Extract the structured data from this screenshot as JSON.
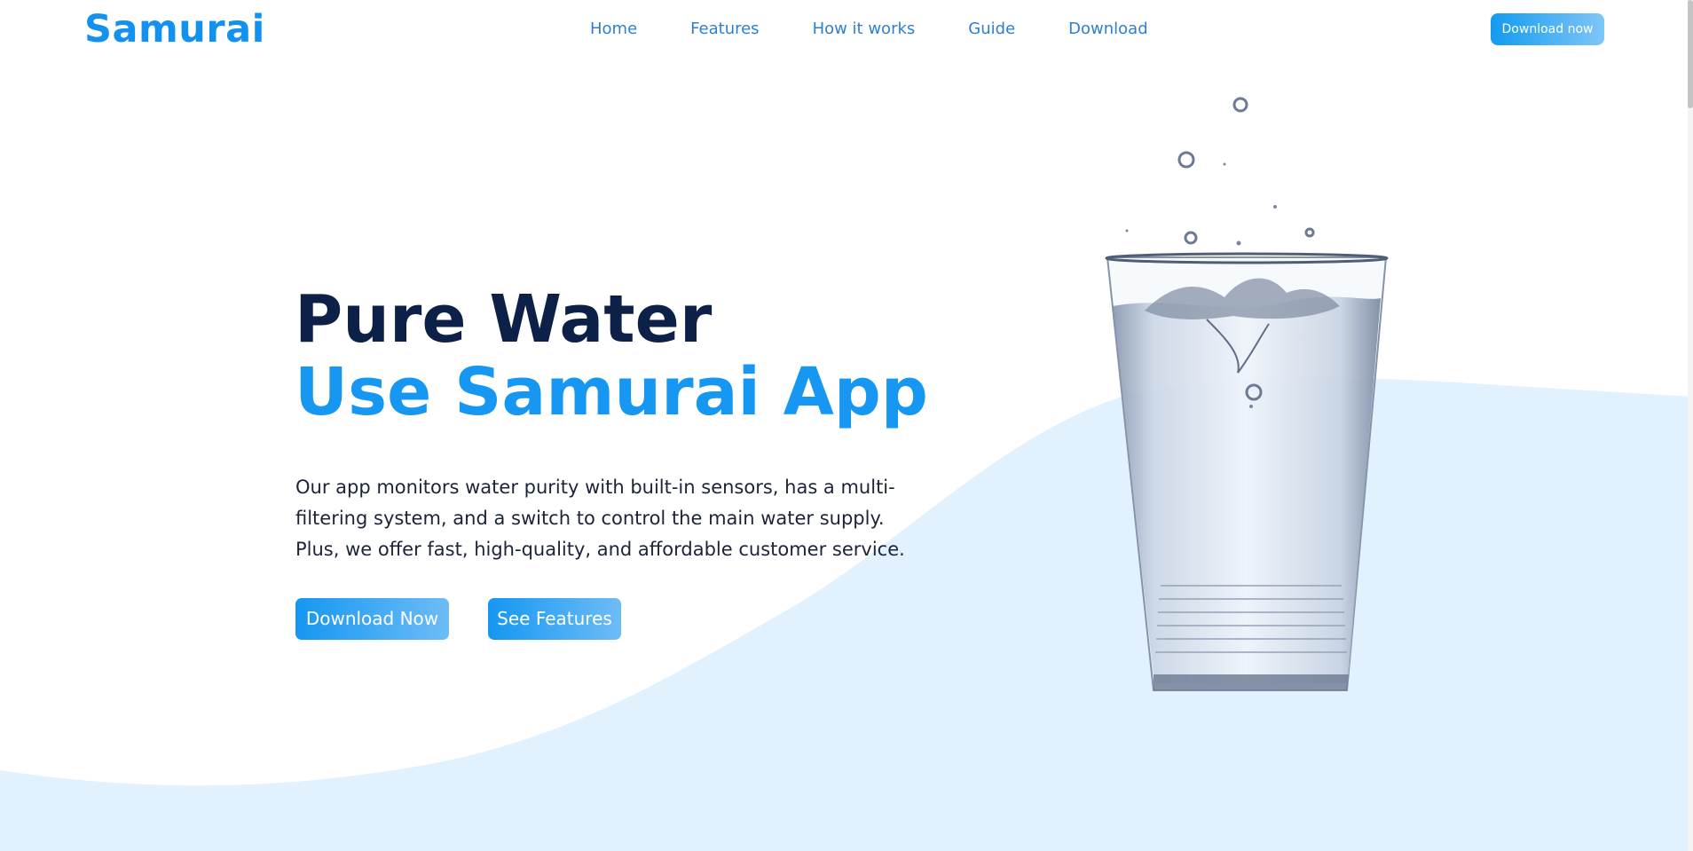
{
  "brand": {
    "logo_text": "Samurai"
  },
  "nav": {
    "items": [
      {
        "label": "Home"
      },
      {
        "label": "Features"
      },
      {
        "label": "How it works"
      },
      {
        "label": "Guide"
      },
      {
        "label": "Download"
      }
    ],
    "cta_label": "Download now"
  },
  "hero": {
    "title_line1": "Pure Water",
    "title_line2": "Use Samurai App",
    "description": "Our app monitors water purity with built-in sensors, has a multi-filtering system, and a switch to control the main water supply. Plus, we offer fast, high-quality, and affordable customer service.",
    "primary_button": "Download Now",
    "secondary_button": "See Features",
    "image_subject": "glass-of-water"
  },
  "colors": {
    "brand_blue": "#1292ee",
    "heading_navy": "#0d2148",
    "wave_fill": "#e1f1fd",
    "nav_link": "#2f7fd0"
  }
}
